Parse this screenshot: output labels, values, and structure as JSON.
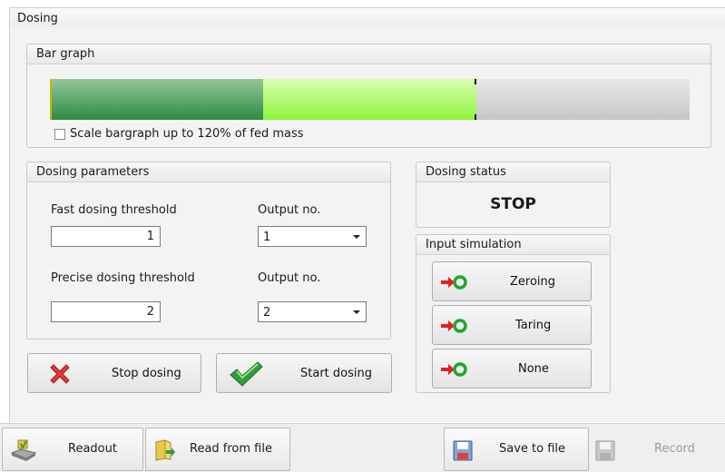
{
  "window": {
    "title": "Dosing"
  },
  "bar_graph": {
    "title": "Bar graph",
    "dark_fill_fraction": 0.333,
    "light_fill_fraction": 0.667,
    "marker_fraction": 0.667,
    "scale_checkbox": {
      "label": "Scale bargraph up to 120% of fed mass",
      "checked": false
    }
  },
  "dosing_parameters": {
    "title": "Dosing parameters",
    "fast_threshold": {
      "label": "Fast dosing threshold",
      "value": "1"
    },
    "fast_output": {
      "label": "Output no.",
      "value": "1"
    },
    "precise_threshold": {
      "label": "Precise dosing threshold",
      "value": "2"
    },
    "precise_output": {
      "label": "Output no.",
      "value": "2"
    }
  },
  "actions": {
    "stop_label": "Stop dosing",
    "start_label": "Start dosing"
  },
  "dosing_status": {
    "title": "Dosing status",
    "value": "STOP"
  },
  "input_simulation": {
    "title": "Input simulation",
    "buttons": [
      "Zeroing",
      "Taring",
      "None"
    ]
  },
  "toolbar": {
    "readout": "Readout",
    "read_from_file": "Read from file",
    "save_to_file": "Save to file",
    "record": "Record"
  },
  "colors": {
    "bar_dark": "#2f8a43",
    "bar_light": "#8ff23a",
    "bar_empty": "#c6c6c6",
    "stop_icon": "#e03a3a",
    "check_icon": "#2e9e3a",
    "sim_arrow": "#e02020",
    "sim_ring": "#22a42b"
  }
}
